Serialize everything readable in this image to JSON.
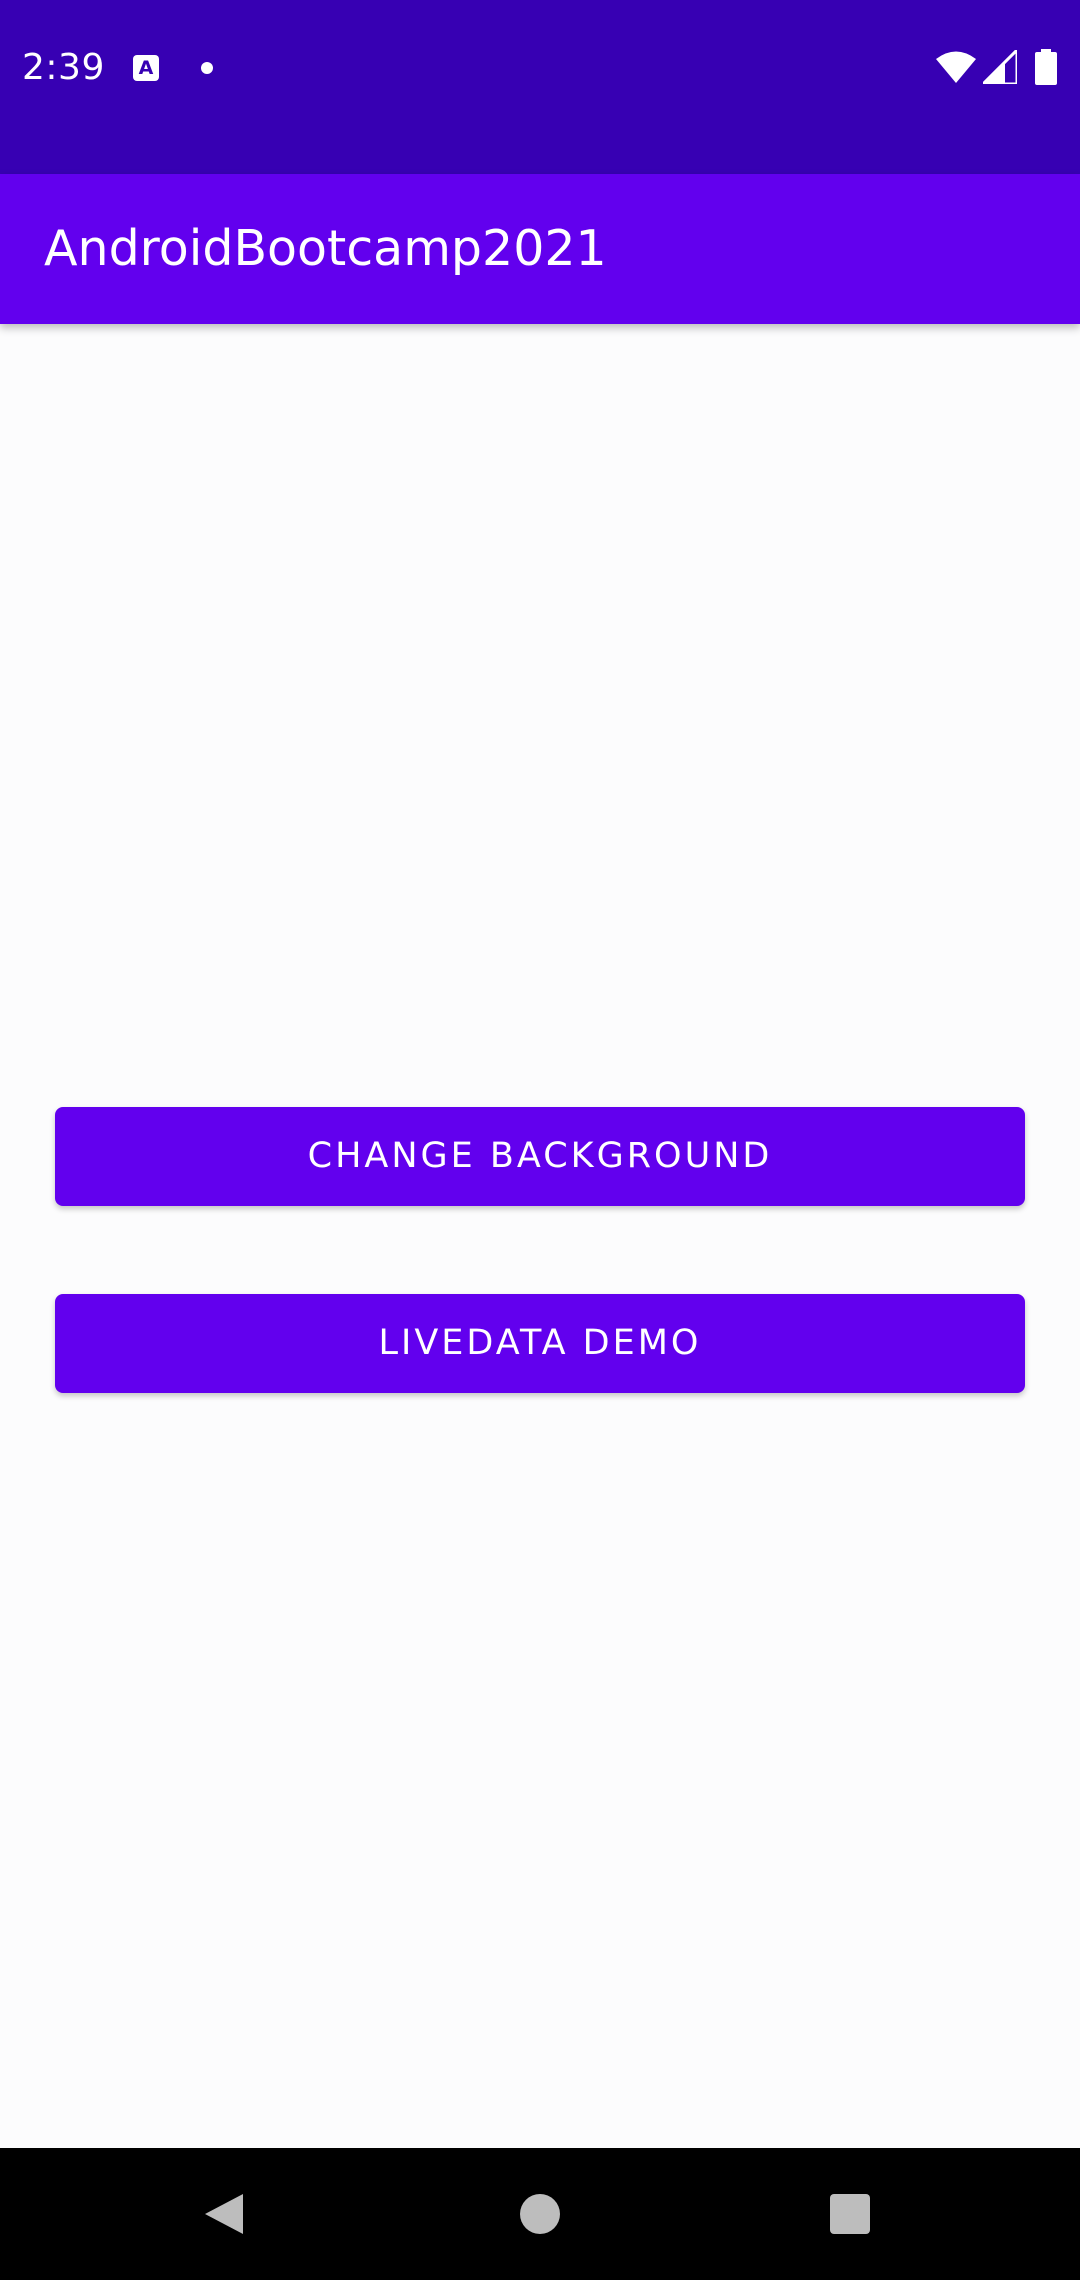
{
  "status_bar": {
    "time": "2:39",
    "notification_icon_letter": "A",
    "icons": [
      "a-notification-icon",
      "dot-icon",
      "wifi-icon",
      "signal-icon",
      "battery-icon"
    ],
    "background_color": "#3700b3"
  },
  "app_bar": {
    "title": "AndroidBootcamp2021",
    "background_color": "#6200ee"
  },
  "main": {
    "buttons": [
      {
        "label": "CHANGE BACKGROUND"
      },
      {
        "label": "LIVEDATA DEMO"
      }
    ],
    "button_color": "#6200ee",
    "background_color": "#fcfcfd"
  },
  "nav_bar": {
    "icons": [
      "back-icon",
      "home-icon",
      "recents-icon"
    ]
  }
}
